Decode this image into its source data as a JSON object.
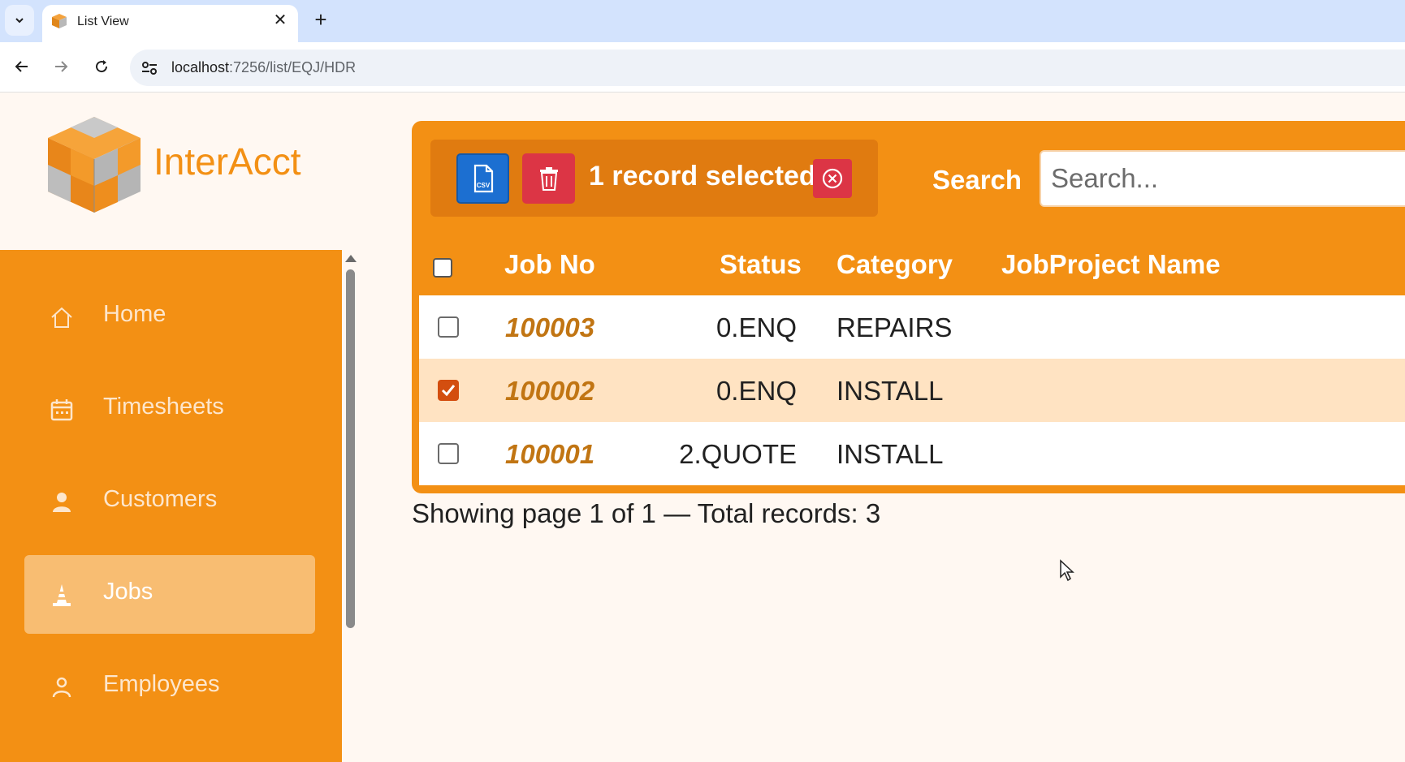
{
  "browser": {
    "tab_title": "List View",
    "url_host": "localhost",
    "url_path": ":7256/list/EQJ/HDR"
  },
  "app": {
    "brand": "InterAcct"
  },
  "sidebar": {
    "items": [
      {
        "label": "Home",
        "icon": "home-icon",
        "active": false
      },
      {
        "label": "Timesheets",
        "icon": "calendar-icon",
        "active": false
      },
      {
        "label": "Customers",
        "icon": "person-icon",
        "active": false
      },
      {
        "label": "Jobs",
        "icon": "traffic-cone-icon",
        "active": true
      },
      {
        "label": "Employees",
        "icon": "person-outline-icon",
        "active": false
      }
    ]
  },
  "toolbar": {
    "csv_label": "CSV",
    "selection_text": "1 record selected",
    "search_label": "Search",
    "search_placeholder": "Search..."
  },
  "table": {
    "columns": [
      "Job No",
      "Status",
      "Category",
      "JobProject Name"
    ],
    "rows": [
      {
        "job_no": "100003",
        "status": "0.ENQ",
        "category": "REPAIRS",
        "name": "",
        "selected": false
      },
      {
        "job_no": "100002",
        "status": "0.ENQ",
        "category": "INSTALL",
        "name": "",
        "selected": true
      },
      {
        "job_no": "100001",
        "status": "2.QUOTE",
        "category": "INSTALL",
        "name": "",
        "selected": false
      }
    ]
  },
  "footer": {
    "text": "Showing page 1 of 1 — Total records: 3"
  },
  "colors": {
    "accent": "#f39014",
    "active_nav": "#f8bd72",
    "selected_row": "#ffe3c2",
    "csv_button": "#1c6fd1",
    "danger": "#dc3545",
    "job_link": "#c17513"
  }
}
